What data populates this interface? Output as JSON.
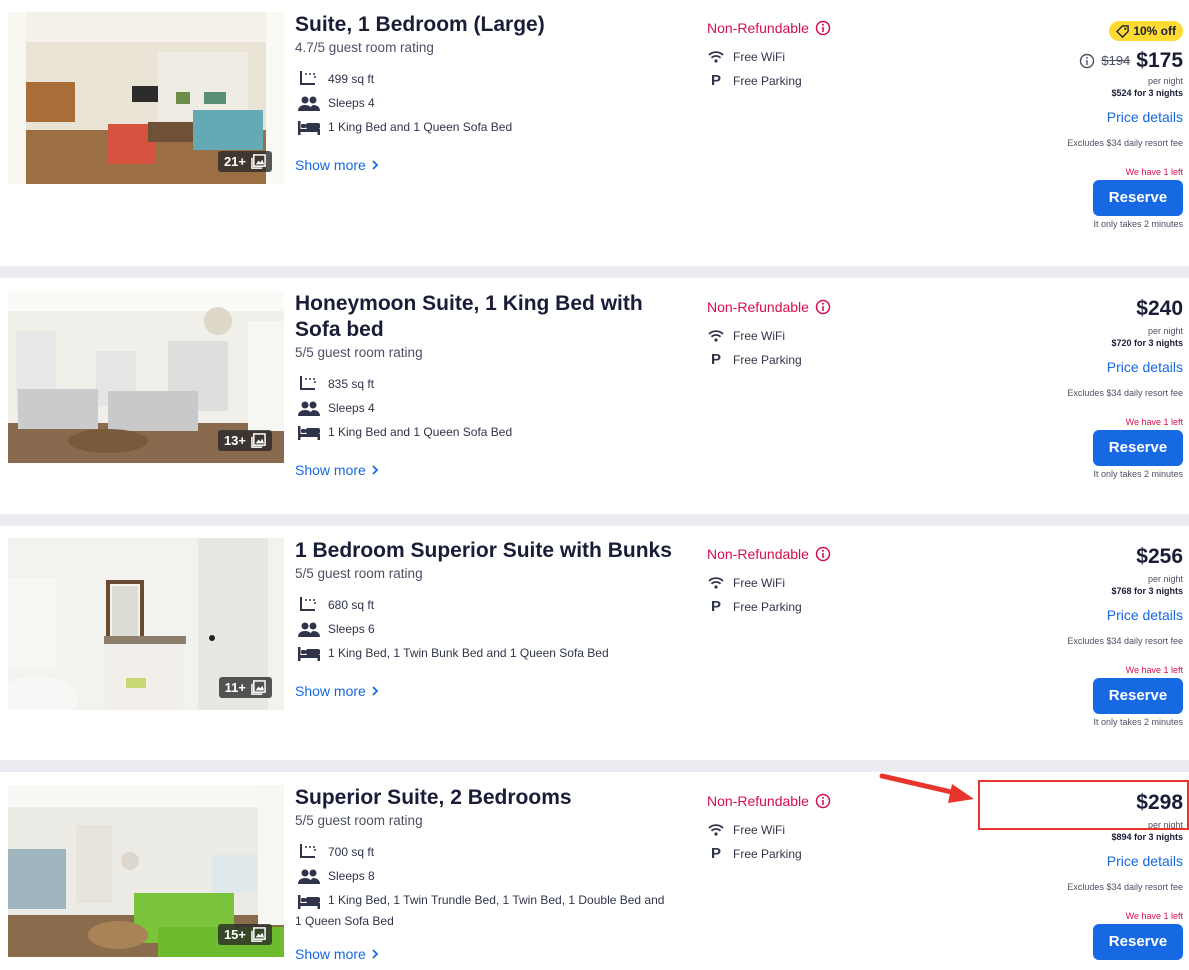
{
  "rooms": [
    {
      "title": "Suite, 1 Bedroom (Large)",
      "rating": "4.7/5 guest room rating",
      "photo_count": "21+",
      "size": "499 sq ft",
      "sleeps": "Sleeps 4",
      "beds": "1 King Bed and 1 Queen Sofa Bed",
      "show_more": "Show more",
      "refund": "Non-Refundable",
      "wifi": "Free WiFi",
      "parking": "Free Parking",
      "badge": "10% off",
      "old_price": "$194",
      "price": "$175",
      "per_night": "per night",
      "total": "$524 for 3 nights",
      "price_details": "Price details",
      "excludes": "Excludes $34 daily resort fee",
      "left": "We have 1 left",
      "reserve": "Reserve",
      "takes": "It only takes 2 minutes"
    },
    {
      "title": "Honeymoon Suite, 1 King Bed with Sofa bed",
      "rating": "5/5 guest room rating",
      "photo_count": "13+",
      "size": "835 sq ft",
      "sleeps": "Sleeps 4",
      "beds": "1 King Bed and 1 Queen Sofa Bed",
      "show_more": "Show more",
      "refund": "Non-Refundable",
      "wifi": "Free WiFi",
      "parking": "Free Parking",
      "price": "$240",
      "per_night": "per night",
      "total": "$720 for 3 nights",
      "price_details": "Price details",
      "excludes": "Excludes $34 daily resort fee",
      "left": "We have 1 left",
      "reserve": "Reserve",
      "takes": "It only takes 2 minutes"
    },
    {
      "title": "1 Bedroom Superior Suite with Bunks",
      "rating": "5/5 guest room rating",
      "photo_count": "11+",
      "size": "680 sq ft",
      "sleeps": "Sleeps 6",
      "beds": "1 King Bed, 1 Twin Bunk Bed and 1 Queen Sofa Bed",
      "show_more": "Show more",
      "refund": "Non-Refundable",
      "wifi": "Free WiFi",
      "parking": "Free Parking",
      "price": "$256",
      "per_night": "per night",
      "total": "$768 for 3 nights",
      "price_details": "Price details",
      "excludes": "Excludes $34 daily resort fee",
      "left": "We have 1 left",
      "reserve": "Reserve",
      "takes": "It only takes 2 minutes"
    },
    {
      "title": "Superior Suite, 2 Bedrooms",
      "rating": "5/5 guest room rating",
      "photo_count": "15+",
      "size": "700 sq ft",
      "sleeps": "Sleeps 8",
      "beds": "1 King Bed, 1 Twin Trundle Bed, 1 Twin Bed, 1 Double Bed and 1 Queen Sofa Bed",
      "show_more": "Show more",
      "refund": "Non-Refundable",
      "wifi": "Free WiFi",
      "parking": "Free Parking",
      "price": "$298",
      "per_night": "per night",
      "total": "$894 for 3 nights",
      "price_details": "Price details",
      "excludes": "Excludes $34 daily resort fee",
      "left": "We have 1 left",
      "reserve": "Reserve"
    }
  ],
  "colors": {
    "accent": "#1668e3",
    "refund_red": "#d70e4c",
    "badge_yellow": "#fddb32",
    "annotation_red": "#e8352b"
  }
}
